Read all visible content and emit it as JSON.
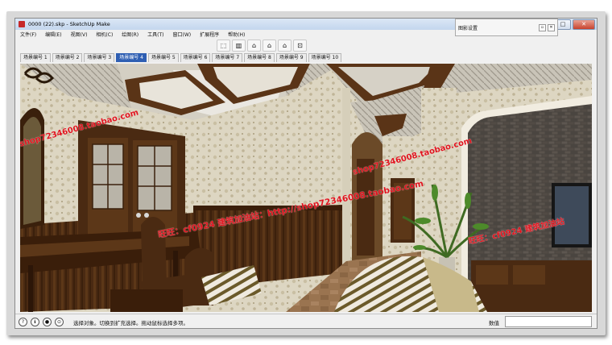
{
  "window": {
    "title": "0000 (22).skp - SketchUp Make",
    "controls": {
      "minimize": "–",
      "maximize": "□",
      "close": "✕"
    }
  },
  "menu": [
    "文件(F)",
    "编辑(E)",
    "视图(V)",
    "相机(C)",
    "绘图(R)",
    "工具(T)",
    "窗口(W)",
    "扩展程序",
    "帮助(H)"
  ],
  "toolbar": {
    "icons": [
      "component-icon",
      "cylinder-icon",
      "house-icon",
      "house-open-icon",
      "house-outline-icon",
      "warehouse-icon"
    ],
    "glyphs": [
      "⬚",
      "▥",
      "⌂",
      "⌂",
      "⌂",
      "⊡"
    ]
  },
  "tray": {
    "title": "图影设置",
    "pin": "▫",
    "close": "✕"
  },
  "scenes": [
    "场景编号 1",
    "场景编号 2",
    "场景编号 3",
    "场景编号 4",
    "场景编号 5",
    "场景编号 6",
    "场景编号 7",
    "场景编号 8",
    "场景编号 9",
    "场景编号 10"
  ],
  "active_scene": 3,
  "watermarks": {
    "shop_left": "shop72346008.taobao.com",
    "shop_mid": "shop72346008.taobao.com",
    "center": "旺旺：cf0924   建筑加油站：http://shop72346008.taobao.com",
    "right": "旺旺：cf0924   建筑加油站"
  },
  "status": {
    "icons": [
      "?",
      "ℹ",
      "●",
      "⊙"
    ],
    "message": "选择对象。切换到扩充选择。拖动鼠标选择多项。",
    "measure_label": "数值",
    "measure_value": ""
  },
  "colors": {
    "active_tab": "#2f5fb3",
    "watermark": "#e0141e",
    "wood": "#5a3417",
    "wallpaper": "#d9d2bd"
  }
}
